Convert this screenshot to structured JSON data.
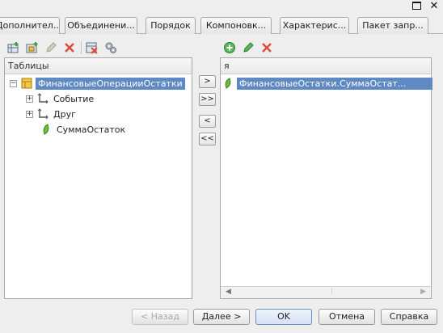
{
  "tabs": [
    {
      "label": "Дополнител..."
    },
    {
      "label": "Объединени..."
    },
    {
      "label": "Порядок"
    },
    {
      "label": "Компоновк..."
    },
    {
      "label": "Характерис..."
    },
    {
      "label": "Пакет запр..."
    }
  ],
  "left_panel": {
    "header": "Таблицы",
    "root": {
      "label": "ФинансовыеОперацииОстатки",
      "expander": "⊟"
    },
    "children": [
      {
        "label": "Событие",
        "expander": "+"
      },
      {
        "label": "Друг",
        "expander": "+"
      },
      {
        "label": "СуммаОстаток"
      }
    ]
  },
  "right_panel": {
    "header": "я",
    "rows": [
      {
        "label": "ФинансовыеОстатки.СуммаОстат..."
      }
    ]
  },
  "move_buttons": {
    "add_one": ">",
    "add_all": ">>",
    "remove_one": "<",
    "remove_all": "<<"
  },
  "footer": {
    "back": "< Назад",
    "next": "Далее >",
    "ok": "OK",
    "cancel": "Отмена",
    "help": "Справка"
  },
  "colors": {
    "selection": "#5e89c3",
    "delete_icon": "#d94a3a",
    "add_icon": "#4aa84a"
  }
}
